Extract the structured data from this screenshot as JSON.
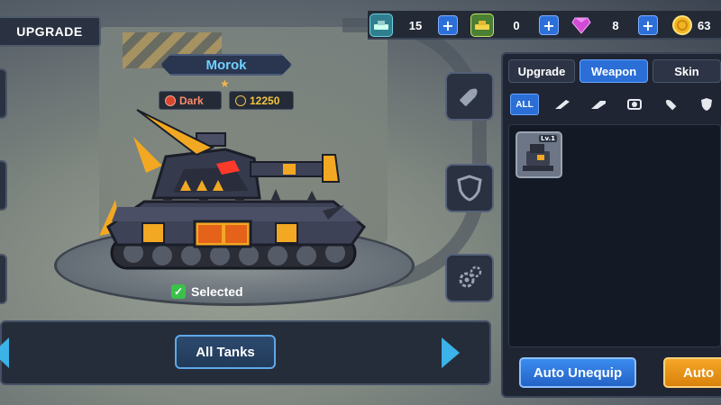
{
  "header": {
    "upgrade_button": "UPGRADE"
  },
  "currency": [
    {
      "icon": "tank-card-icon",
      "value": "15"
    },
    {
      "icon": "gold-tank-icon",
      "value": "0"
    },
    {
      "icon": "gem-icon",
      "value": "8"
    },
    {
      "icon": "coin-icon",
      "value": "63"
    }
  ],
  "tank": {
    "name": "Morok",
    "element": "Dark",
    "power": "12250",
    "star_icon": "★",
    "status": "Selected"
  },
  "bottom": {
    "all_tanks_button": "All Tanks"
  },
  "panel": {
    "tabs": [
      "Upgrade",
      "Weapon",
      "Skin"
    ],
    "active_tab": "Weapon",
    "filters": [
      "ALL"
    ],
    "item_level": "Lv.1",
    "auto_unequip_button": "Auto Unequip",
    "auto_button": "Auto"
  },
  "colors": {
    "accent_blue": "#2a6ed6",
    "name_cyan": "#6fd0ff",
    "orange": "#f5a627",
    "check_green": "#39c14a"
  }
}
